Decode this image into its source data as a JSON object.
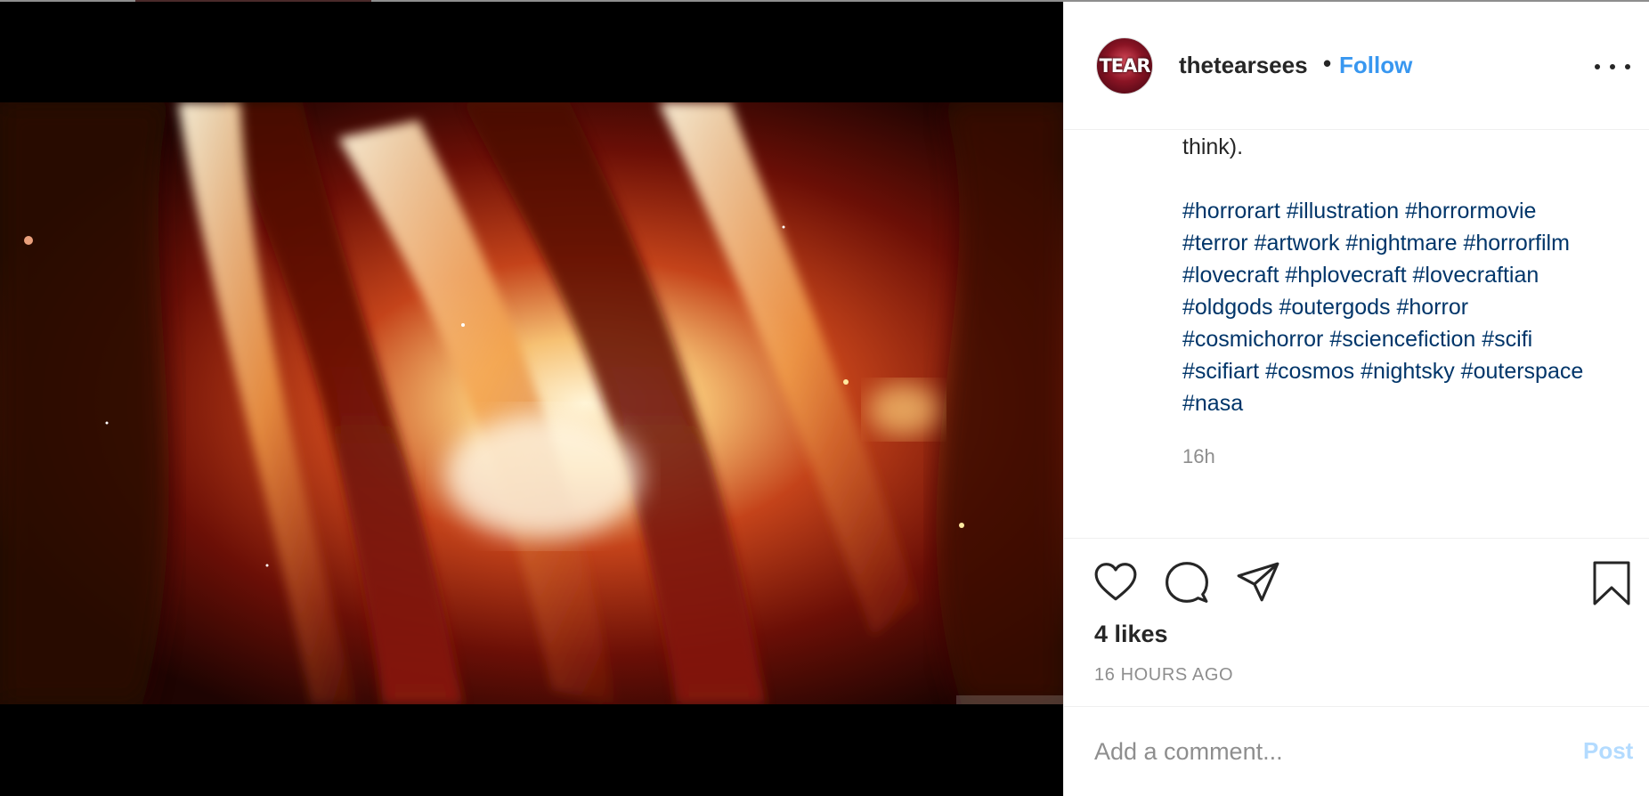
{
  "post": {
    "username": "thetearsees",
    "separator": "•",
    "follow_label": "Follow",
    "avatar_text": "TEAR",
    "caption_tail": "think).",
    "hashtag_lines": [
      [
        "#horrorart",
        "#illustration",
        "#horrormovie"
      ],
      [
        "#terror",
        "#artwork",
        "#nightmare",
        "#horrorfilm"
      ],
      [
        "#lovecraft",
        "#hplovecraft",
        "#lovecraftian"
      ],
      [
        "#oldgods",
        "#outergods",
        "#horror"
      ],
      [
        "#cosmichorror",
        "#sciencefiction",
        "#scifi"
      ],
      [
        "#scifiart",
        "#cosmos",
        "#nightsky",
        "#outerspace"
      ],
      [
        "#nasa"
      ]
    ],
    "caption_time": "16h",
    "likes": "4 likes",
    "time_ago": "16 HOURS AGO"
  },
  "comment": {
    "placeholder": "Add a comment...",
    "post_label": "Post"
  },
  "icons": {
    "like": "heart-icon",
    "comment": "speech-bubble-icon",
    "share": "paper-plane-icon",
    "save": "bookmark-icon",
    "more": "ellipsis-icon"
  },
  "colors": {
    "link_blue": "#3897f0",
    "hashtag_blue": "#003569",
    "text_dark": "#262626",
    "text_muted": "#8e8e8e",
    "post_disabled": "#b3dbff"
  }
}
